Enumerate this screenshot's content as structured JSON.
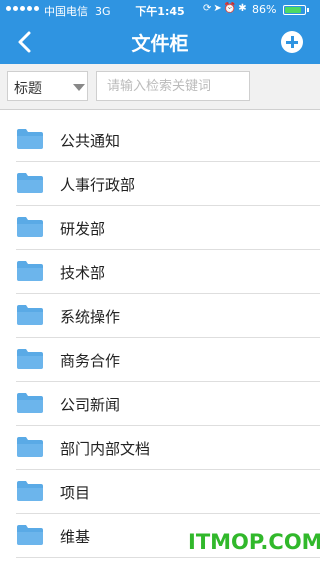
{
  "status_bar": {
    "carrier": "中国电信",
    "network": "3G",
    "time": "下午1:45",
    "battery_text": "86%",
    "battery_level": 0.86,
    "icons": [
      "rotation-lock-icon",
      "location-icon",
      "alarm-icon",
      "bluetooth-icon"
    ]
  },
  "nav": {
    "title": "文件柜",
    "back_icon": "chevron-left-icon",
    "add_icon": "plus-circle-icon"
  },
  "search": {
    "filter_value": "标题",
    "placeholder": "请输入检索关键词"
  },
  "folders": [
    {
      "label": "公共通知"
    },
    {
      "label": "人事行政部"
    },
    {
      "label": "研发部"
    },
    {
      "label": "技术部"
    },
    {
      "label": "系统操作"
    },
    {
      "label": "商务合作"
    },
    {
      "label": "公司新闻"
    },
    {
      "label": "部门内部文档"
    },
    {
      "label": "项目"
    },
    {
      "label": "维基"
    }
  ],
  "watermark": "ITMOP.COM",
  "colors": {
    "header": "#2f94e1",
    "folder": "#5aaae6",
    "watermark": "#31b82b"
  }
}
